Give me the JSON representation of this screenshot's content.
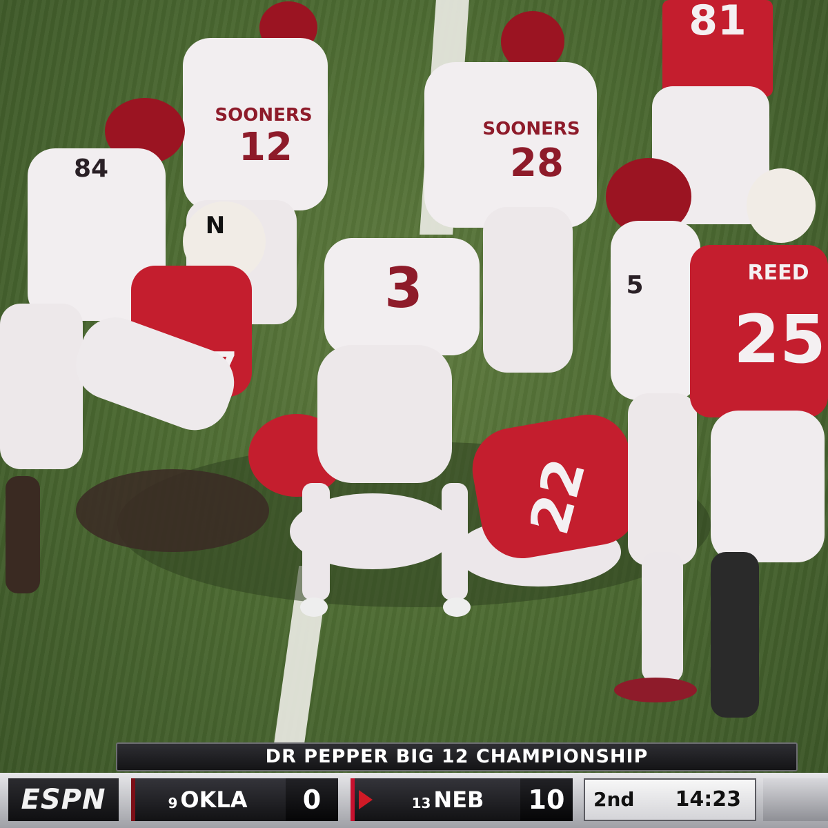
{
  "scene": {
    "field_color": "#4c6a32",
    "oklahoma_jersey_color": "#f2eef0",
    "oklahoma_number_color": "#8e1b2a",
    "nebraska_jersey_color": "#c41e2e",
    "helmet_oklahoma_color": "#9b1422"
  },
  "players": {
    "okla_12": {
      "number": "12",
      "chest_text": "SOONERS"
    },
    "okla_28": {
      "number": "28",
      "chest_text": "SOONERS"
    },
    "okla_84": {
      "number": "84"
    },
    "okla_3": {
      "number": "3"
    },
    "okla_5": {
      "number": "5"
    },
    "neb_81": {
      "number": "81"
    },
    "neb_25": {
      "number": "25",
      "name": "REED"
    },
    "neb_22": {
      "number": "22"
    },
    "neb_57": {
      "number": "57"
    },
    "neb_helmet_letter": "N"
  },
  "scorebug": {
    "network_logo": "ESPN",
    "title": "DR PEPPER BIG 12 CHAMPIONSHIP",
    "away": {
      "rank": "9",
      "name": "OKLA",
      "score": "0",
      "color": "#7b0f17"
    },
    "home": {
      "rank": "13",
      "name": "NEB",
      "score": "10",
      "color": "#c8102e",
      "possession": true
    },
    "quarter": "2nd",
    "clock": "14:23"
  }
}
